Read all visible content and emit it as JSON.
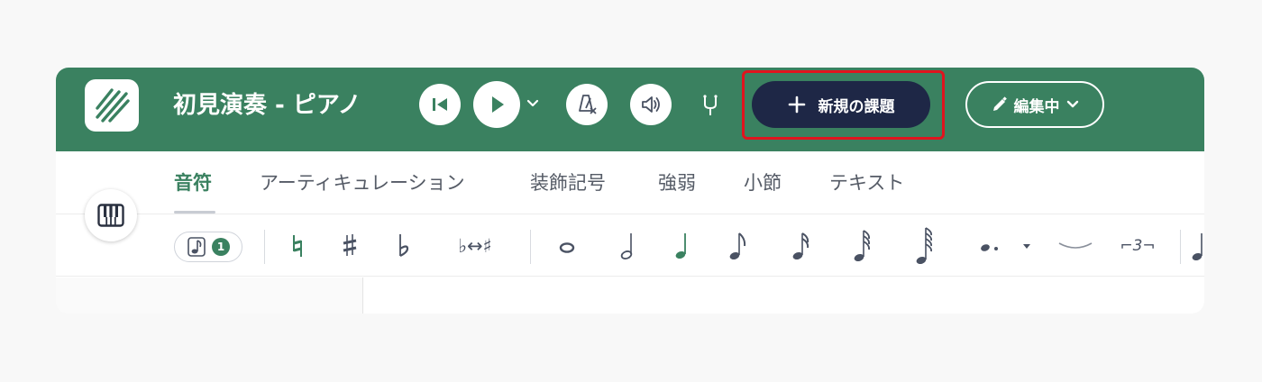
{
  "header": {
    "title": "初見演奏 - ピアノ",
    "new_task_label": "新規の課題",
    "edit_label": "編集中",
    "bg_color": "#3a8160",
    "primary_button_color": "#1e2746",
    "highlight_color": "#e0141e",
    "icons": [
      "logo-icon",
      "skip-back-icon",
      "play-icon",
      "chevron-down-icon",
      "metronome-off-icon",
      "volume-icon",
      "tuning-fork-icon",
      "plus-icon",
      "pencil-icon",
      "chevron-down-icon"
    ]
  },
  "tabs": {
    "items": [
      "音符",
      "アーティキュレーション",
      "装飾記号",
      "強弱",
      "小節",
      "テキスト"
    ],
    "active": "音符"
  },
  "tools": {
    "voice_badge": "1",
    "enharmonic_label": "♭↔♯",
    "tuplet_label": "⌐3¬",
    "icons": [
      "voice-note-icon",
      "natural-icon",
      "sharp-icon",
      "flat-icon",
      "enharmonic-icon",
      "whole-note-icon",
      "half-note-icon",
      "quarter-note-icon",
      "eighth-note-icon",
      "sixteenth-note-icon",
      "thirty-second-note-icon",
      "sixty-fourth-note-icon",
      "dotted-note-icon",
      "tie-icon",
      "tuplet-icon"
    ]
  }
}
